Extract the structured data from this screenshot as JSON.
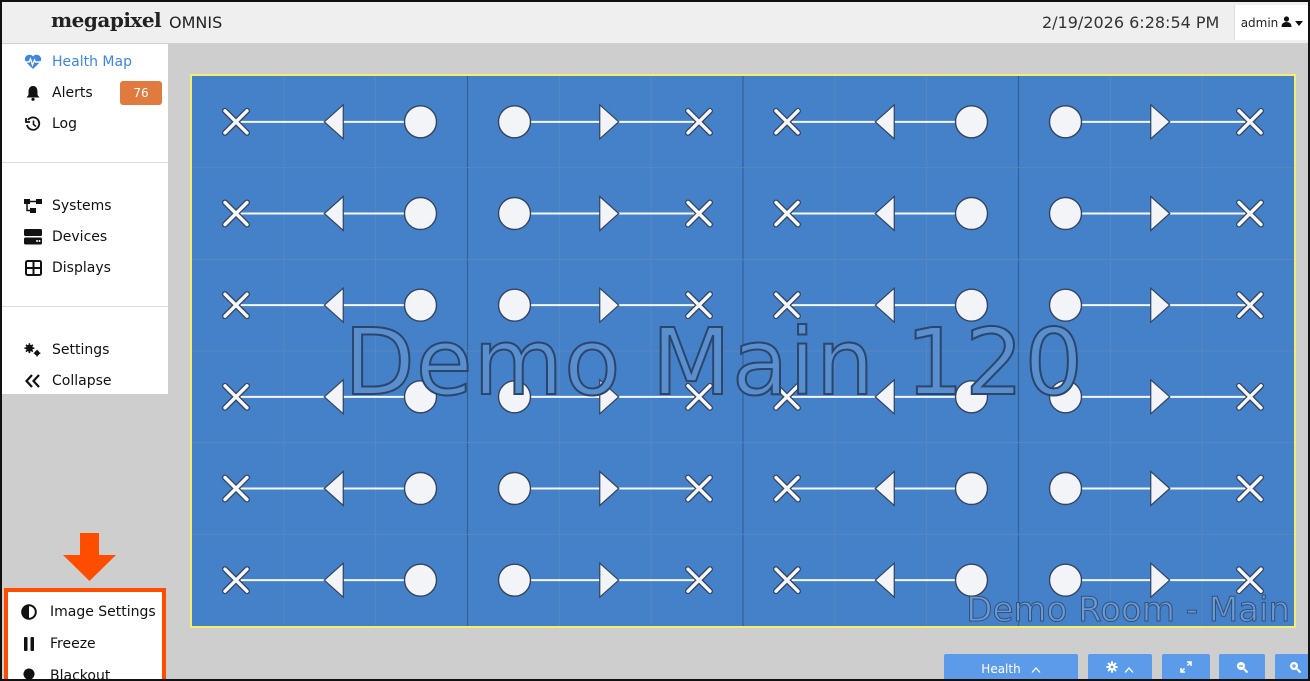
{
  "header": {
    "logo": "megapixel",
    "app_name": "OMNIS",
    "datetime": "2/19/2026 6:28:54 PM",
    "user": "admin"
  },
  "sidebar": {
    "items": [
      {
        "label": "Health Map",
        "icon": "heart-pulse-icon",
        "active": true
      },
      {
        "label": "Alerts",
        "icon": "bell-icon",
        "badge": "76"
      },
      {
        "label": "Log",
        "icon": "history-icon"
      },
      {
        "label": "Systems",
        "icon": "network-icon"
      },
      {
        "label": "Devices",
        "icon": "server-icon"
      },
      {
        "label": "Displays",
        "icon": "grid-icon"
      },
      {
        "label": "Settings",
        "icon": "gears-icon"
      },
      {
        "label": "Collapse",
        "icon": "double-chevron-left-icon"
      }
    ],
    "bottom_items": [
      {
        "label": "Image Settings",
        "icon": "contrast-icon"
      },
      {
        "label": "Freeze",
        "icon": "pause-icon"
      },
      {
        "label": "Blackout",
        "icon": "lightbulb-icon"
      }
    ]
  },
  "display": {
    "name": "Demo Main 120",
    "room": "Demo Room - Main",
    "columns": 12,
    "rows": 6
  },
  "toolbar": {
    "health_label": "Health"
  },
  "colors": {
    "accent": "#3d86e6",
    "badge": "#e07a3f",
    "highlight": "#ff4d00",
    "display_bg": "#4581c8",
    "display_border": "#f3ee6c",
    "button": "#5b9be9"
  }
}
